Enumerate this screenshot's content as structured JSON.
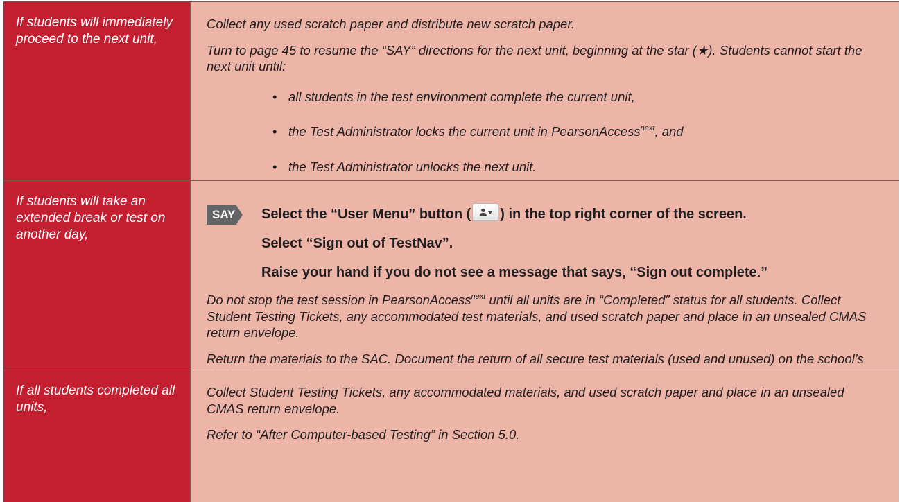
{
  "rows": [
    {
      "condition": "If students will immediately proceed to the next unit,",
      "paragraphs": [
        "Collect any used scratch paper and distribute new scratch paper.",
        "Turn to page 45 to resume the “SAY” directions for the next unit, beginning at the star (★). Students cannot start the next unit until:"
      ],
      "bullets": {
        "b1": "all students in the test environment complete the current unit,",
        "b2_pre": "the Test Administrator locks the current unit in PearsonAccess",
        "b2_sup": "next",
        "b2_post": ", and",
        "b3": "the Test Administrator unlocks the next unit."
      },
      "bullet_glyph": "•"
    },
    {
      "condition": "If students will take an extended break or test on another day,",
      "say_badge": "SAY",
      "say_line1_pre": "Select the “User Menu” button (",
      "say_line1_post": ") in the top right corner of the screen.",
      "say_line2": "Select “Sign out of TestNav”.",
      "say_line3": "Raise your hand if you do not see a message that says, “Sign out complete.”",
      "p1_pre": "Do not stop the test session in PearsonAccess",
      "p1_sup": "next",
      "p1_post": " until all units are in “Completed” status for all students. Collect Student Testing Tickets, any accommodated test materials, and used scratch paper and place in an unsealed CMAS return envelope.",
      "p2": "Return the materials to the SAC. Document the return of all secure test materials (used and unused) on the school’s chain of custody form."
    },
    {
      "condition": "If all students completed all units,",
      "p1": "Collect Student Testing Tickets, any accommodated materials, and used scratch paper and place in an unsealed CMAS return envelope.",
      "p2": "Refer to “After Computer-based Testing” in Section 5.0."
    }
  ],
  "colors": {
    "condition_bg": "#c41e31",
    "body_bg": "#ecb5a8",
    "say_badge_bg": "#626466"
  },
  "icons": {
    "user_menu_button": "user-menu-icon"
  }
}
